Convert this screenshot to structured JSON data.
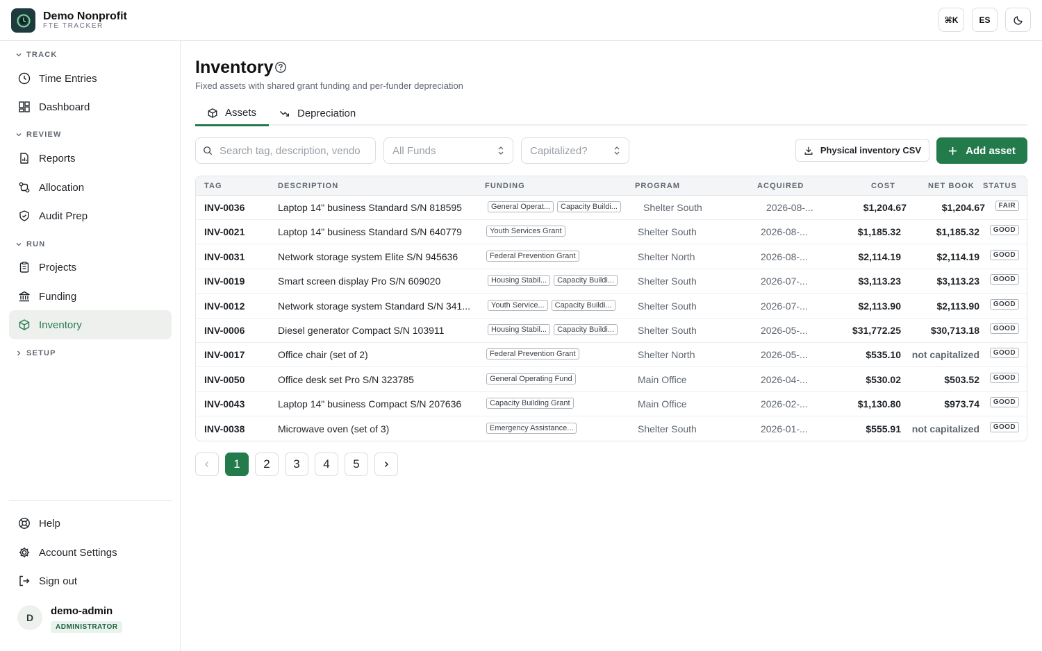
{
  "brand": {
    "name": "Demo Nonprofit",
    "subtitle": "FTE TRACKER"
  },
  "topbar": {
    "shortcut_label": "⌘K",
    "lang_label": "ES",
    "theme_icon": "moon-icon"
  },
  "sidebar": {
    "sections": [
      {
        "label": "TRACK",
        "items": [
          {
            "label": "Time Entries",
            "icon": "clock-icon"
          },
          {
            "label": "Dashboard",
            "icon": "dashboard-icon"
          }
        ]
      },
      {
        "label": "REVIEW",
        "items": [
          {
            "label": "Reports",
            "icon": "report-icon"
          },
          {
            "label": "Allocation",
            "icon": "allocation-icon"
          },
          {
            "label": "Audit Prep",
            "icon": "shield-icon"
          }
        ]
      },
      {
        "label": "RUN",
        "items": [
          {
            "label": "Projects",
            "icon": "clipboard-icon"
          },
          {
            "label": "Funding",
            "icon": "bank-icon"
          },
          {
            "label": "Inventory",
            "icon": "box-icon",
            "active": true
          }
        ]
      },
      {
        "label": "SETUP",
        "collapsed": true,
        "items": []
      }
    ],
    "footer_items": [
      {
        "label": "Help",
        "icon": "lifebuoy-icon"
      },
      {
        "label": "Account Settings",
        "icon": "gear-icon"
      },
      {
        "label": "Sign out",
        "icon": "sign-out-icon"
      }
    ],
    "user": {
      "initial": "D",
      "name": "demo-admin",
      "role": "ADMINISTRATOR"
    }
  },
  "page": {
    "title": "Inventory",
    "subtitle": "Fixed assets with shared grant funding and per-funder depreciation",
    "tabs": [
      {
        "label": "Assets",
        "icon": "box-icon",
        "active": true
      },
      {
        "label": "Depreciation",
        "icon": "trend-down-icon"
      }
    ]
  },
  "filters": {
    "search_placeholder": "Search tag, description, vendo",
    "funds_placeholder": "All Funds",
    "capitalized_placeholder": "Capitalized?",
    "csv_button": "Physical inventory CSV",
    "add_button": "Add asset"
  },
  "table": {
    "headers": {
      "tag": "TAG",
      "description": "DESCRIPTION",
      "funding": "FUNDING",
      "program": "PROGRAM",
      "acquired": "ACQUIRED",
      "cost": "COST",
      "net_book": "NET BOOK",
      "status": "STATUS"
    },
    "rows": [
      {
        "tag": "INV-0036",
        "description": "Laptop 14\" business Standard S/N 818595",
        "funding": [
          "General Operat...",
          "Capacity Buildi..."
        ],
        "program": "Shelter South",
        "acquired": "2026-08-...",
        "cost": "$1,204.67",
        "net_book": "$1,204.67",
        "status": "FAIR"
      },
      {
        "tag": "INV-0021",
        "description": "Laptop 14\" business Standard S/N 640779",
        "funding": [
          "Youth Services Grant"
        ],
        "program": "Shelter South",
        "acquired": "2026-08-...",
        "cost": "$1,185.32",
        "net_book": "$1,185.32",
        "status": "GOOD"
      },
      {
        "tag": "INV-0031",
        "description": "Network storage system Elite S/N 945636",
        "funding": [
          "Federal Prevention Grant"
        ],
        "program": "Shelter North",
        "acquired": "2026-08-...",
        "cost": "$2,114.19",
        "net_book": "$2,114.19",
        "status": "GOOD"
      },
      {
        "tag": "INV-0019",
        "description": "Smart screen display Pro S/N 609020",
        "funding": [
          "Housing Stabil...",
          "Capacity Buildi..."
        ],
        "program": "Shelter South",
        "acquired": "2026-07-...",
        "cost": "$3,113.23",
        "net_book": "$3,113.23",
        "status": "GOOD"
      },
      {
        "tag": "INV-0012",
        "description": "Network storage system Standard S/N 341...",
        "funding": [
          "Youth Service...",
          "Capacity Buildi..."
        ],
        "program": "Shelter South",
        "acquired": "2026-07-...",
        "cost": "$2,113.90",
        "net_book": "$2,113.90",
        "status": "GOOD"
      },
      {
        "tag": "INV-0006",
        "description": "Diesel generator Compact S/N 103911",
        "funding": [
          "Housing Stabil...",
          "Capacity Buildi..."
        ],
        "program": "Shelter South",
        "acquired": "2026-05-...",
        "cost": "$31,772.25",
        "net_book": "$30,713.18",
        "status": "GOOD"
      },
      {
        "tag": "INV-0017",
        "description": "Office chair (set of 2)",
        "funding": [
          "Federal Prevention Grant"
        ],
        "program": "Shelter North",
        "acquired": "2026-05-...",
        "cost": "$535.10",
        "net_book": "not capitalized",
        "status": "GOOD"
      },
      {
        "tag": "INV-0050",
        "description": "Office desk set Pro S/N 323785",
        "funding": [
          "General Operating Fund"
        ],
        "program": "Main Office",
        "acquired": "2026-04-...",
        "cost": "$530.02",
        "net_book": "$503.52",
        "status": "GOOD"
      },
      {
        "tag": "INV-0043",
        "description": "Laptop 14\" business Compact S/N 207636",
        "funding": [
          "Capacity Building Grant"
        ],
        "program": "Main Office",
        "acquired": "2026-02-...",
        "cost": "$1,130.80",
        "net_book": "$973.74",
        "status": "GOOD"
      },
      {
        "tag": "INV-0038",
        "description": "Microwave oven (set of 3)",
        "funding": [
          "Emergency Assistance..."
        ],
        "program": "Shelter South",
        "acquired": "2026-01-...",
        "cost": "$555.91",
        "net_book": "not capitalized",
        "status": "GOOD"
      }
    ]
  },
  "pagination": {
    "pages": [
      "1",
      "2",
      "3",
      "4",
      "5"
    ],
    "current": "1"
  },
  "colors": {
    "accent": "#237a4b",
    "brand_tile": "#1f3a3d",
    "active_nav_bg": "#eef0ee"
  }
}
